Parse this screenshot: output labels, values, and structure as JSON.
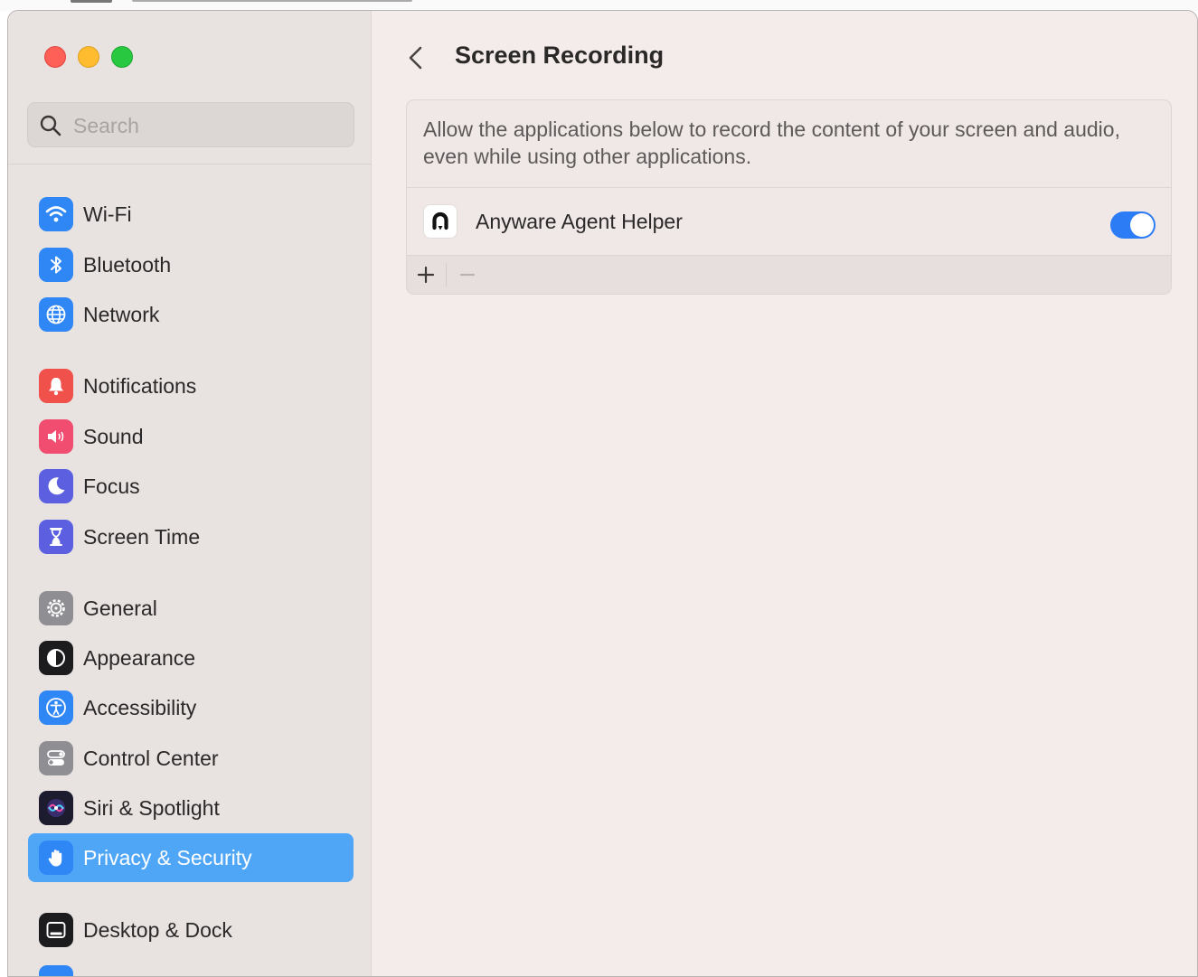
{
  "sidebar": {
    "search": {
      "placeholder": "Search",
      "value": ""
    },
    "items": [
      {
        "id": "wifi",
        "label": "Wi-Fi",
        "icon": "wifi-icon",
        "color": "#2f87f5"
      },
      {
        "id": "bluetooth",
        "label": "Bluetooth",
        "icon": "bluetooth-icon",
        "color": "#2f87f5"
      },
      {
        "id": "network",
        "label": "Network",
        "icon": "globe-icon",
        "color": "#2f87f5"
      },
      {
        "id": "notifications",
        "label": "Notifications",
        "icon": "bell-icon",
        "color": "#f0514a"
      },
      {
        "id": "sound",
        "label": "Sound",
        "icon": "speaker-icon",
        "color": "#f04d70"
      },
      {
        "id": "focus",
        "label": "Focus",
        "icon": "moon-icon",
        "color": "#5b5fe0"
      },
      {
        "id": "screen-time",
        "label": "Screen Time",
        "icon": "hourglass-icon",
        "color": "#5b5fe0"
      },
      {
        "id": "general",
        "label": "General",
        "icon": "gear-icon",
        "color": "#8e8e93"
      },
      {
        "id": "appearance",
        "label": "Appearance",
        "icon": "appearance-icon",
        "color": "#1c1c1e"
      },
      {
        "id": "accessibility",
        "label": "Accessibility",
        "icon": "accessibility-icon",
        "color": "#2f87f5"
      },
      {
        "id": "control-center",
        "label": "Control Center",
        "icon": "switches-icon",
        "color": "#8e8e93"
      },
      {
        "id": "siri-spotlight",
        "label": "Siri & Spotlight",
        "icon": "siri-icon",
        "color": "#3a2d6e"
      },
      {
        "id": "privacy-security",
        "label": "Privacy & Security",
        "icon": "hand-icon",
        "color": "#2f87f5",
        "selected": true
      },
      {
        "id": "desktop-dock",
        "label": "Desktop & Dock",
        "icon": "dock-icon",
        "color": "#1c1c1e"
      }
    ]
  },
  "main": {
    "title": "Screen Recording",
    "description": "Allow the applications below to record the content of your screen and audio, even while using other applications.",
    "apps": [
      {
        "name": "Anyware Agent Helper",
        "icon": "anyware-app-icon",
        "enabled": true
      }
    ],
    "accent": "#2c7cf6"
  }
}
